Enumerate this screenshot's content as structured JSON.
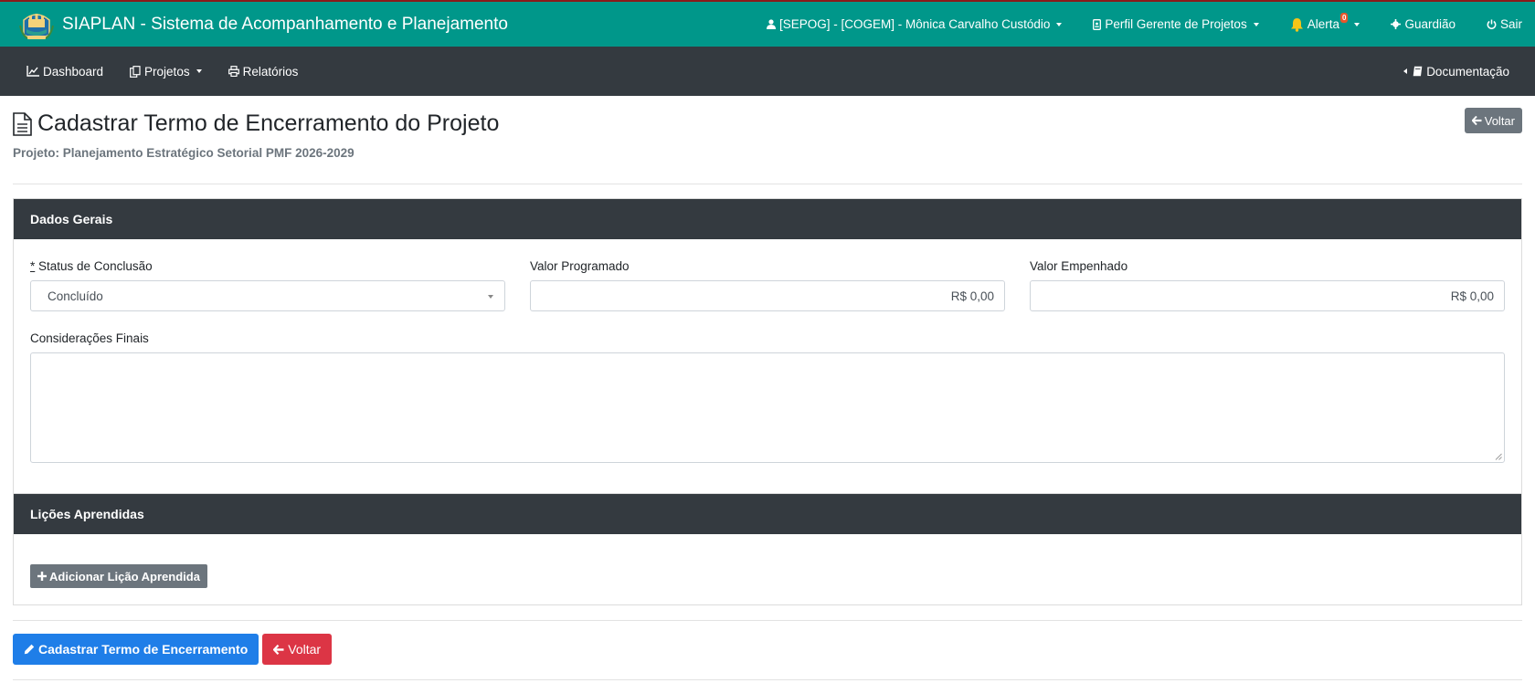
{
  "header": {
    "title": "SIAPLAN - Sistema de Acompanhamento e Planejamento",
    "user": "[SEPOG] - [COGEM] - Mônica Carvalho Custódio",
    "profile": "Perfil Gerente de Projetos",
    "alerts_label": "Alerta",
    "alerts_count": "0",
    "guardian": "Guardião",
    "logout": "Sair",
    "colors": {
      "header_bg": "#00978a",
      "top_accent": "#8b1a1a"
    }
  },
  "nav": {
    "dashboard": "Dashboard",
    "projects": "Projetos",
    "reports": "Relatórios",
    "documentation": "Documentação"
  },
  "page": {
    "title": "Cadastrar Termo de Encerramento do Projeto",
    "subtitle": "Projeto: Planejamento Estratégico Setorial PMF 2026-2029",
    "back_top": "Voltar"
  },
  "general": {
    "section_title": "Dados Gerais",
    "status_required_mark": "*",
    "status_label": " Status de Conclusão",
    "status_value": "Concluído",
    "programmed_label": "Valor Programado",
    "programmed_value": "R$ 0,00",
    "committed_label": "Valor Empenhado",
    "committed_value": "R$ 0,00",
    "final_considerations_label": "Considerações Finais",
    "final_considerations_value": ""
  },
  "lessons": {
    "section_title": "Lições Aprendidas",
    "add_button": "Adicionar Lição Aprendida"
  },
  "actions": {
    "submit": "Cadastrar Termo de Encerramento",
    "back": "Voltar",
    "colors": {
      "primary": "#1f7ee8",
      "danger": "#dc3545"
    }
  }
}
